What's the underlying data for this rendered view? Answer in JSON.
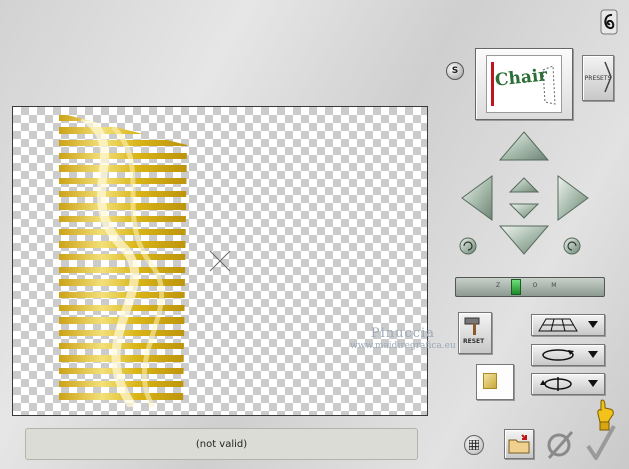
{
  "preset_thumbnail": {
    "label": "Chair"
  },
  "presets_button": {
    "label": "PRESETS"
  },
  "s_button": {
    "label": "S"
  },
  "zoom_slider": {
    "label": "Z O O M",
    "level": 0.5
  },
  "reset_button": {
    "label": "RESET"
  },
  "watermark": {
    "title": "Pinuccia",
    "url": "www.maidiregrafica.eu"
  },
  "status_bar": {
    "text": "(not valid)"
  },
  "icons": {
    "logo": "spiral-logo-icon",
    "nav": [
      "up-arrow-icon",
      "left-arrow-icon",
      "right-arrow-icon",
      "down-arrow-icon",
      "center-up-icon",
      "center-down-icon",
      "rotate-left-icon",
      "rotate-right-icon"
    ],
    "tools": [
      "hammer-icon",
      "plane-grid-icon",
      "rotate-loop-icon",
      "flip-loop-icon",
      "thumbnail-swatch-icon",
      "pointing-hand-icon",
      "grid-icon",
      "folder-icon",
      "cancel-icon",
      "ok-check-icon"
    ]
  },
  "colors": {
    "accent_gold": "#d4b30c",
    "status_bg": "#dcdcd6",
    "arrow_green": "#9fb5a4"
  }
}
